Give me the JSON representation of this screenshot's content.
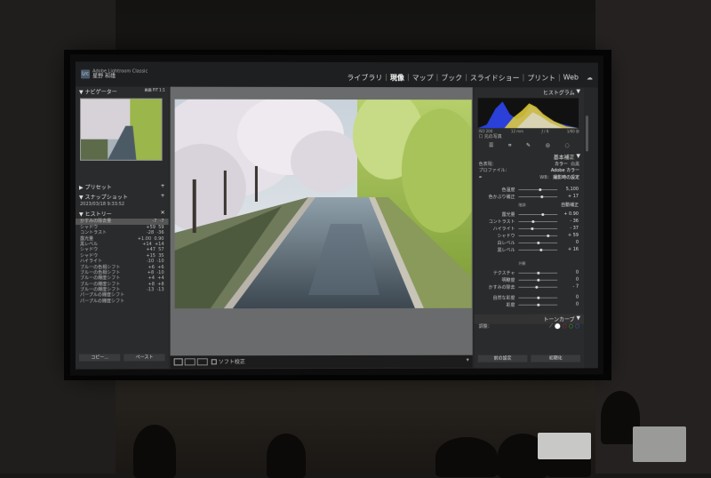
{
  "module_bar": [
    "ライブラリ",
    "現像",
    "マップ",
    "ブック",
    "スライドショー",
    "プリント",
    "Web"
  ],
  "active_module": "現像",
  "brand": {
    "line1": "Adobe Lightroom Classic",
    "line2": "星野 和雄"
  },
  "left_panel": {
    "navigator": "ナビゲーター",
    "presets": "プリセット",
    "snapshots": "スナップショット",
    "snapshot_item": "2023/03/18 9:33:52",
    "history": "ヒストリー",
    "history_items": [
      {
        "label": "かすみの除去量",
        "a": "-7",
        "b": "-7"
      },
      {
        "label": "シャドウ",
        "a": "+59",
        "b": "59"
      },
      {
        "label": "コントラスト",
        "a": "-28",
        "b": "-36"
      },
      {
        "label": "露光量",
        "a": "+1.00",
        "b": "0.90"
      },
      {
        "label": "黒レベル",
        "a": "+14",
        "b": "+14"
      },
      {
        "label": "シャドウ",
        "a": "+47",
        "b": "57"
      },
      {
        "label": "シャドウ",
        "a": "+15",
        "b": "35"
      },
      {
        "label": "ハイライト",
        "a": "-10",
        "b": "-10"
      },
      {
        "label": "ブルーの色相シフト",
        "a": "+6",
        "b": "+6"
      },
      {
        "label": "ブルーの色相シフト",
        "a": "+8",
        "b": "-10"
      },
      {
        "label": "ブルーの輝度シフト",
        "a": "+4",
        "b": "+4"
      },
      {
        "label": "ブルーの輝度シフト",
        "a": "+8",
        "b": "+8"
      },
      {
        "label": "ブルーの輝度シフト",
        "a": "-13",
        "b": "-13"
      },
      {
        "label": "パープルの輝度シフト",
        "a": "",
        "b": ""
      },
      {
        "label": "パープルの輝度シフト",
        "a": "",
        "b": ""
      }
    ],
    "copy_btn": "コピー...",
    "paste_btn": "ペースト"
  },
  "right_panel": {
    "histogram": "ヒストグラム",
    "hist_info": [
      "ISO 200",
      "12 mm",
      "ƒ / 8",
      "1/60 秒"
    ],
    "original_photo": "元の写真",
    "basic": "基本補正",
    "treatment_label": "色表現：",
    "treatment_color": "カラー",
    "treatment_bw": "白黒",
    "profile_label": "プロファイル：",
    "profile_value": "Adobe カラー",
    "wb_label": "WB：",
    "wb_value": "撮影時の設定",
    "sliders": [
      {
        "label": "色温度",
        "value": "5,100",
        "pos": 0.55
      },
      {
        "label": "色かぶり補正",
        "value": "+ 17",
        "pos": 0.6
      },
      {
        "label": "露光量",
        "value": "+ 0.90",
        "pos": 0.62
      },
      {
        "label": "コントラスト",
        "value": "- 36",
        "pos": 0.38
      },
      {
        "label": "ハイライト",
        "value": "- 37",
        "pos": 0.36
      },
      {
        "label": "シャドウ",
        "value": "+ 59",
        "pos": 0.75
      },
      {
        "label": "白レベル",
        "value": "0",
        "pos": 0.5
      },
      {
        "label": "黒レベル",
        "value": "+ 16",
        "pos": 0.58
      },
      {
        "label": "テクスチャ",
        "value": "0",
        "pos": 0.5
      },
      {
        "label": "明瞭度",
        "value": "0",
        "pos": 0.5
      },
      {
        "label": "かすみの除去",
        "value": "- 7",
        "pos": 0.46
      },
      {
        "label": "自然な彩度",
        "value": "0",
        "pos": 0.5
      },
      {
        "label": "彩度",
        "value": "0",
        "pos": 0.5
      }
    ],
    "tone_label": "階調",
    "auto_label": "自動補正",
    "presence_label": "外観",
    "tone_curve": "トーンカーブ",
    "adjust_label": "調整：",
    "prev_btn": "前の設定",
    "reset_btn": "初期化"
  },
  "bottom_bar": {
    "soft_proof": "ソフト校正"
  }
}
